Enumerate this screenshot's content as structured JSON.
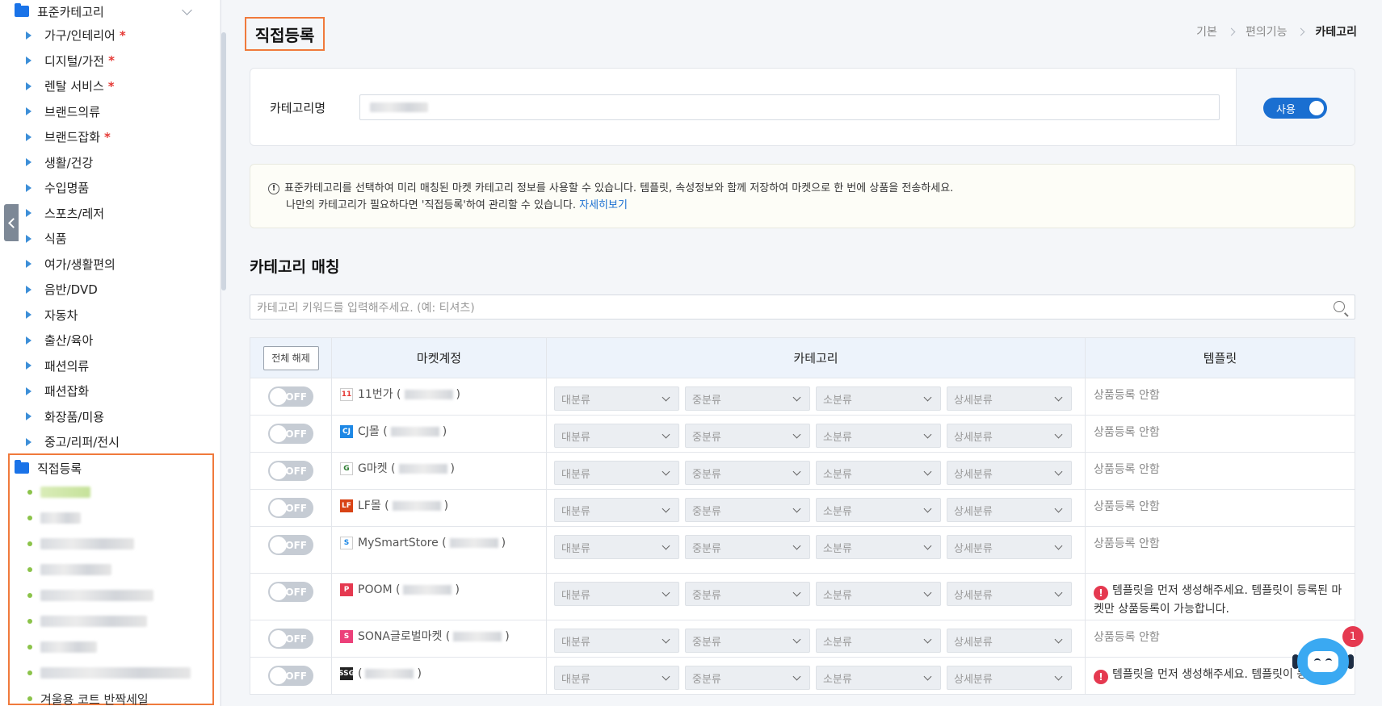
{
  "sidebar": {
    "std_folder": "표준카테고리",
    "std_items": [
      {
        "label": "가구/인테리어",
        "req": "*"
      },
      {
        "label": "디지털/가전",
        "req": "*"
      },
      {
        "label": "렌탈 서비스",
        "req": "*"
      },
      {
        "label": "브랜드의류",
        "req": ""
      },
      {
        "label": "브랜드잡화",
        "req": "*"
      },
      {
        "label": "생활/건강",
        "req": ""
      },
      {
        "label": "수입명품",
        "req": ""
      },
      {
        "label": "스포츠/레저",
        "req": ""
      },
      {
        "label": "식품",
        "req": ""
      },
      {
        "label": "여가/생활편의",
        "req": ""
      },
      {
        "label": "음반/DVD",
        "req": ""
      },
      {
        "label": "자동차",
        "req": ""
      },
      {
        "label": "출산/육아",
        "req": ""
      },
      {
        "label": "패션의류",
        "req": ""
      },
      {
        "label": "패션잡화",
        "req": ""
      },
      {
        "label": "화장품/미용",
        "req": ""
      },
      {
        "label": "중고/리퍼/전시",
        "req": ""
      }
    ],
    "direct_folder": "직접등록",
    "direct_last_item": "겨울용 코트 반짝세일"
  },
  "header": {
    "title": "직접등록",
    "breadcrumb": [
      "기본",
      "편의기능",
      "카테고리"
    ]
  },
  "name_card": {
    "label": "카테고리명",
    "toggle_label": "사용"
  },
  "notice": {
    "line1": "표준카테고리를 선택하여 미리 매칭된 마켓 카테고리 정보를 사용할 수 있습니다. 템플릿, 속성정보와 함께 저장하여 마켓으로 한 번에 상품을 전송하세요.",
    "line2": "나만의 카테고리가 필요하다면 '직접등록'하여 관리할 수 있습니다.",
    "link": "자세히보기"
  },
  "matching": {
    "title": "카테고리 매칭",
    "search_placeholder": "카테고리 키워드를 입력해주세요. (예: 티셔츠)",
    "clear_all": "전체 해제",
    "col_market": "마켓계정",
    "col_category": "카테고리",
    "col_template": "템플릿",
    "toggle_off": "OFF",
    "selects": [
      "대분류",
      "중분류",
      "소분류",
      "상세분류"
    ],
    "rows": [
      {
        "market": "11번가 (",
        "close": ")",
        "logo": "11",
        "logo_color": "#e53935",
        "logo_bg": "#fff",
        "template": "상품등록 안함",
        "warn": false
      },
      {
        "market": "CJ몰 (",
        "close": ")",
        "logo": "CJ",
        "logo_color": "#fff",
        "logo_bg": "#1e88e5",
        "template": "상품등록 안함",
        "warn": false
      },
      {
        "market": "G마켓 (",
        "close": ")",
        "logo": "G",
        "logo_color": "#2e7d32",
        "logo_bg": "#fff",
        "template": "상품등록 안함",
        "warn": false
      },
      {
        "market": "LF몰 (",
        "close": ")",
        "logo": "LF",
        "logo_color": "#fff",
        "logo_bg": "#d84315",
        "template": "상품등록 안함",
        "warn": false
      },
      {
        "market": "MySmartStore (",
        "close": ")",
        "logo": "S",
        "logo_color": "#1e88e5",
        "logo_bg": "#fff",
        "template": "상품등록 안함",
        "warn": false
      },
      {
        "market": "POOM (",
        "close": ")",
        "logo": "P",
        "logo_color": "#fff",
        "logo_bg": "#e53950",
        "template": "템플릿을 먼저 생성해주세요. 템플릿이 등록된 마켓만 상품등록이 가능합니다.",
        "warn": true
      },
      {
        "market": "SONA글로벌마켓 (",
        "close": ")",
        "logo": "S",
        "logo_color": "#fff",
        "logo_bg": "#ec407a",
        "template": "상품등록 안함",
        "warn": false
      },
      {
        "market": "(",
        "close": ")",
        "logo": "SSG",
        "logo_color": "#fff",
        "logo_bg": "#222",
        "template": "템플릿을 먼저 생성해주세요. 템플릿이 등록된",
        "warn": true
      }
    ]
  },
  "chat": {
    "badge": "1"
  }
}
